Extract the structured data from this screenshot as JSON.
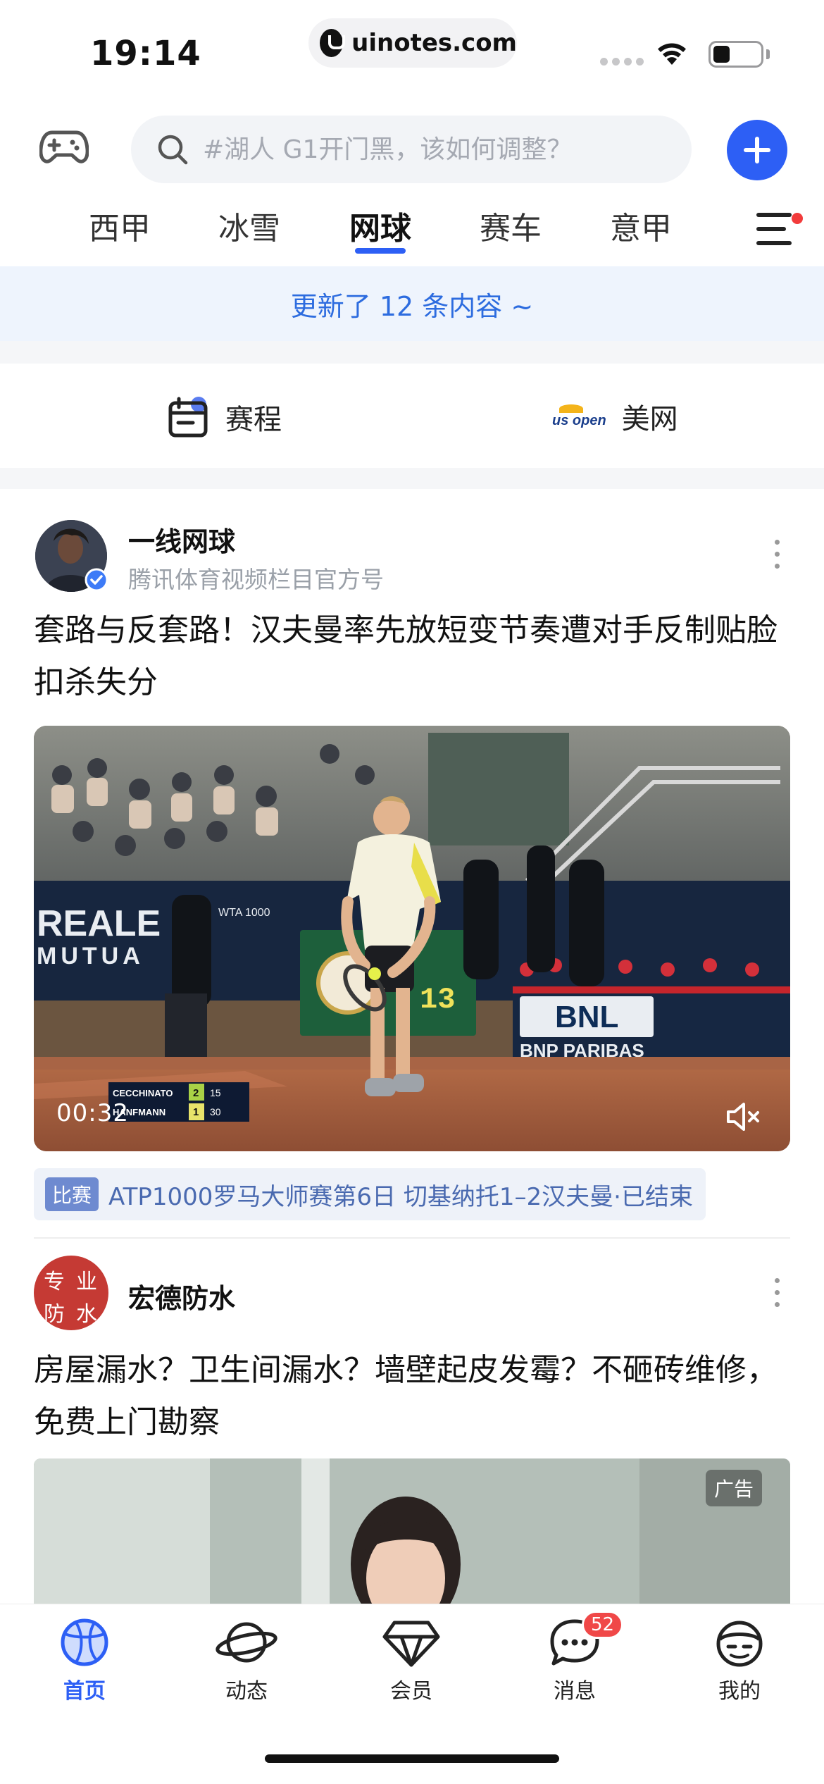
{
  "status_bar": {
    "time": "19:14",
    "url": "uinotes.com",
    "battery_level": 0.35
  },
  "search": {
    "placeholder": "#湖人 G1开门黑，该如何调整？"
  },
  "tabs": [
    {
      "label": "西甲",
      "active": false
    },
    {
      "label": "冰雪",
      "active": false
    },
    {
      "label": "网球",
      "active": true
    },
    {
      "label": "赛车",
      "active": false
    },
    {
      "label": "意甲",
      "active": false
    }
  ],
  "update_banner": "更新了 12 条内容 ~",
  "quick_entries": [
    {
      "label": "赛程",
      "icon": "calendar-icon"
    },
    {
      "label": "美网",
      "icon": "usopen-logo",
      "logo_text": "us open"
    }
  ],
  "posts": [
    {
      "author": "一线网球",
      "subtitle": "腾讯体育视频栏目官方号",
      "title": "套路与反套路！汉夫曼率先放短变节奏遭对手反制贴脸扣杀失分",
      "video": {
        "duration": "00:32",
        "scoreboard": {
          "p1": "CECCHINATO",
          "p1_sets": "2",
          "p1_pts": "15",
          "p2": "HANFMANN",
          "p2_sets": "1",
          "p2_pts": "30"
        },
        "boards": {
          "left": "REALE",
          "left2": "MUTUA",
          "right": "BNL",
          "right2": "BNP PARIBAS",
          "clock": "13",
          "wta": "WTA 1000"
        }
      },
      "match_tag": {
        "badge": "比赛",
        "text": "ATP1000罗马大师赛第6日 切基纳托1–2汉夫曼·已结束"
      }
    },
    {
      "author": "宏德防水",
      "avatar_text": [
        "专",
        "业",
        "防",
        "水"
      ],
      "title": "房屋漏水？卫生间漏水？墙壁起皮发霉？不砸砖维修，免费上门勘察",
      "ad_label": "广告"
    }
  ],
  "bottom_nav": [
    {
      "label": "首页",
      "icon": "basketball-icon",
      "active": true
    },
    {
      "label": "动态",
      "icon": "planet-icon",
      "active": false
    },
    {
      "label": "会员",
      "icon": "diamond-icon",
      "active": false
    },
    {
      "label": "消息",
      "icon": "chat-icon",
      "active": false,
      "badge": "52"
    },
    {
      "label": "我的",
      "icon": "profile-icon",
      "active": false
    }
  ],
  "colors": {
    "accent": "#2d5ff5",
    "banner_bg": "#eef4fd",
    "badge_red": "#f04848"
  }
}
